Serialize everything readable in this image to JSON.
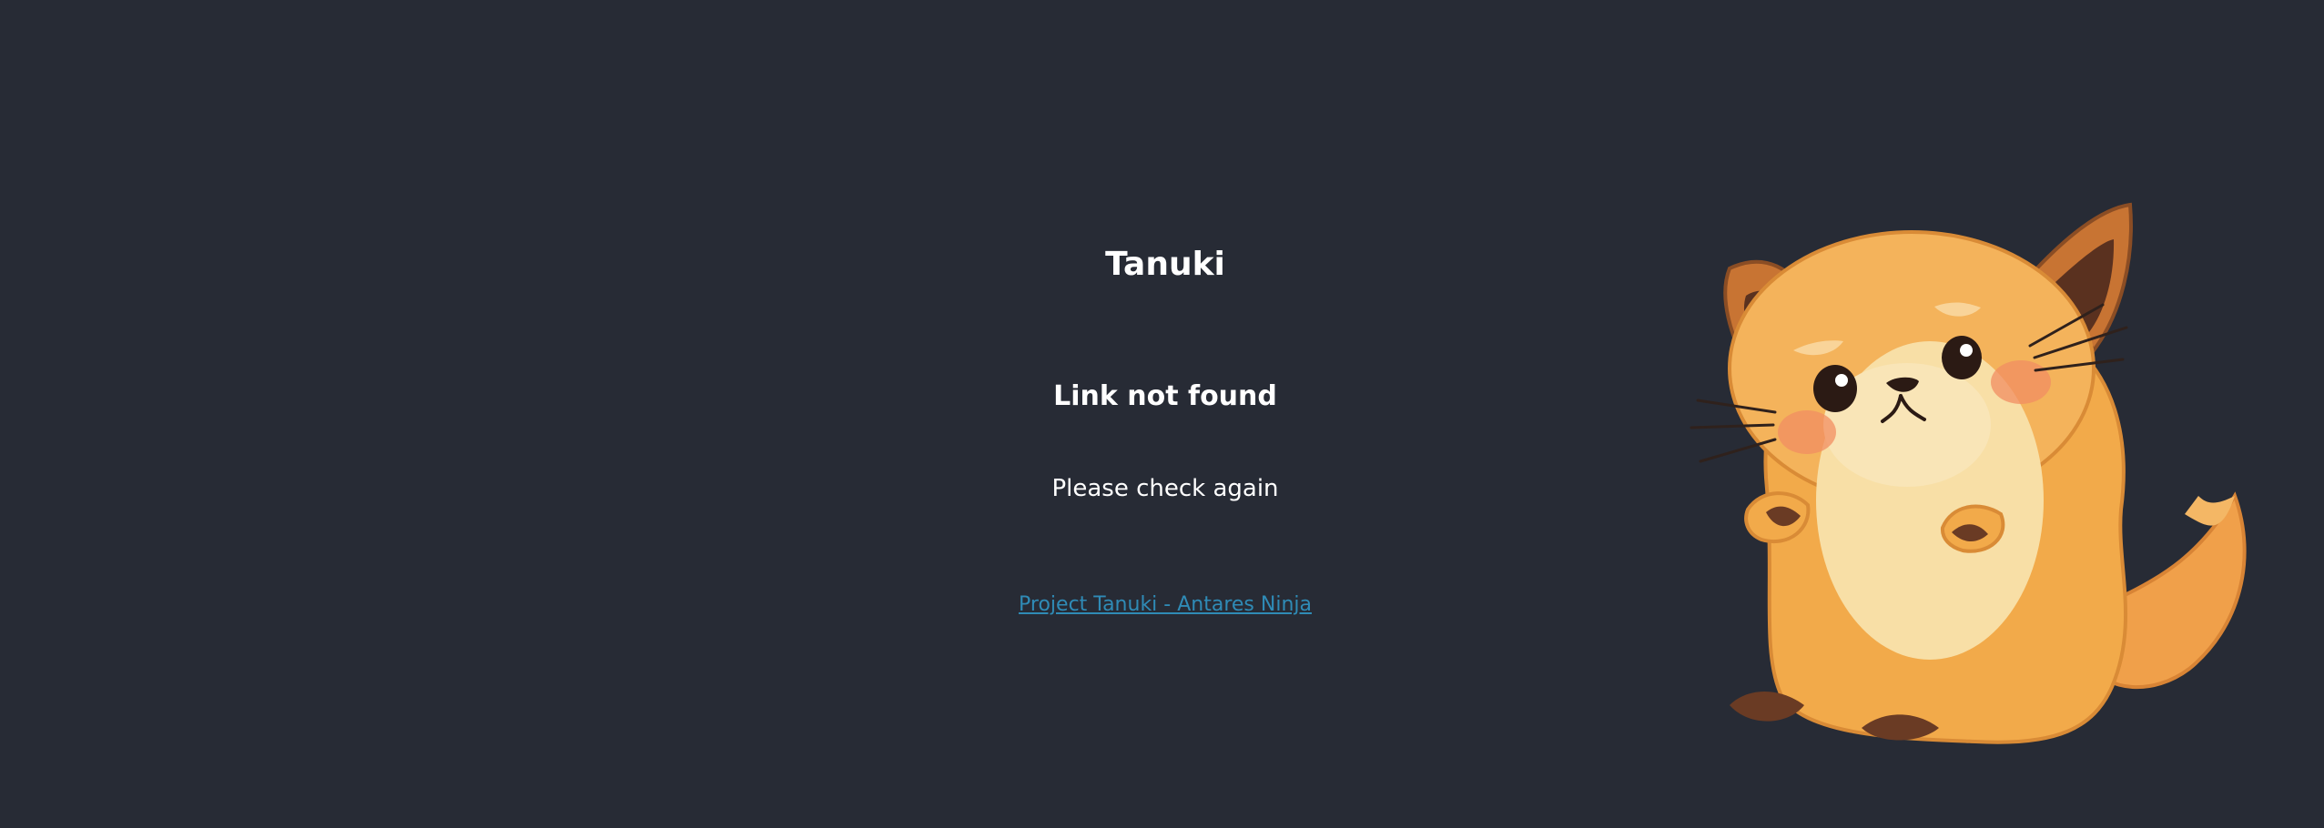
{
  "app": {
    "title": "Tanuki"
  },
  "error": {
    "heading": "Link not found",
    "message": "Please check again"
  },
  "footer": {
    "link_text": "Project Tanuki - Antares Ninja"
  },
  "colors": {
    "background": "#272b35",
    "text": "#ffffff",
    "link": "#2f8bb6",
    "fur": "#f3a847",
    "belly": "#f8e0a8",
    "dark_fur": "#6a3b24"
  },
  "illustration": {
    "subject": "tanuki mascot"
  }
}
